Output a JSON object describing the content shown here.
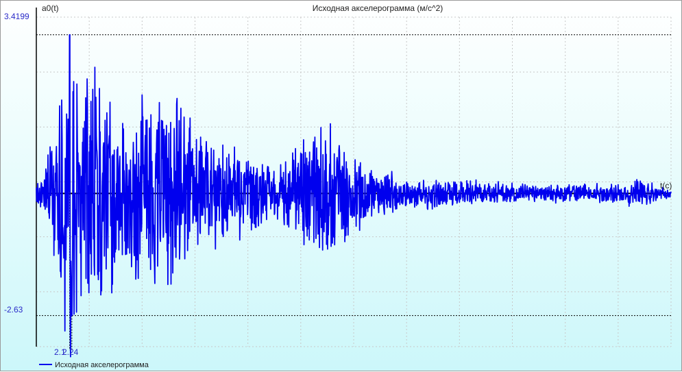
{
  "chart_data": {
    "type": "line",
    "title": "Исходная акселерограмма (м/с^2)",
    "ylabel": "a0(t)",
    "xlabel": "t(с)",
    "ymax_label": "3.4199",
    "ymin_label": "-2.63",
    "x_markers_label": [
      "2.1",
      "2.24"
    ],
    "ylim": [
      -3.3,
      3.8
    ],
    "xlim": [
      0,
      40
    ],
    "grid": true,
    "legend": "bottom-left",
    "colors": {
      "series": "#0000ee",
      "grid": "#c8c8c8",
      "axis": "#000000",
      "ref_line": "#000000"
    },
    "series": [
      {
        "name": "Исходная акселерограмма",
        "envelope": [
          [
            0.0,
            0.2
          ],
          [
            0.6,
            0.5
          ],
          [
            1.1,
            1.8
          ],
          [
            1.6,
            2.4
          ],
          [
            2.1,
            3.4
          ],
          [
            2.6,
            2.6
          ],
          [
            3.5,
            3.1
          ],
          [
            4.5,
            2.2
          ],
          [
            5.5,
            1.7
          ],
          [
            6.6,
            2.2
          ],
          [
            7.5,
            2.3
          ],
          [
            8.7,
            2.6
          ],
          [
            9.8,
            1.5
          ],
          [
            11.0,
            1.2
          ],
          [
            12.5,
            1.0
          ],
          [
            14.0,
            0.8
          ],
          [
            16.0,
            0.75
          ],
          [
            17.0,
            1.3
          ],
          [
            18.2,
            1.6
          ],
          [
            19.5,
            1.1
          ],
          [
            20.8,
            0.6
          ],
          [
            22.5,
            0.45
          ],
          [
            24.0,
            0.35
          ],
          [
            27.0,
            0.3
          ],
          [
            30.0,
            0.22
          ],
          [
            34.0,
            0.2
          ],
          [
            37.0,
            0.2
          ],
          [
            38.0,
            0.35
          ],
          [
            39.0,
            0.2
          ],
          [
            40.0,
            0.1
          ]
        ],
        "ref_points": [
          {
            "x": 2.1,
            "y": 3.4199
          },
          {
            "x": 2.24,
            "y": -2.63
          }
        ]
      }
    ]
  }
}
